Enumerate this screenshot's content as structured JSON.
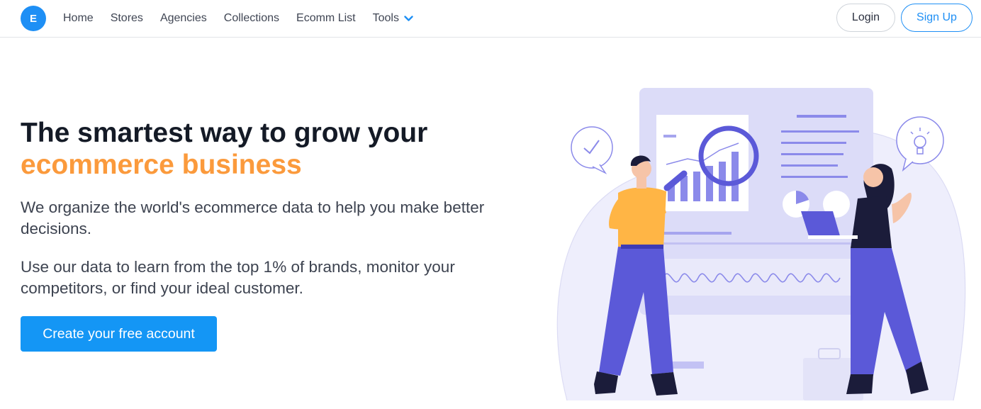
{
  "brand": {
    "logo_letter": "E"
  },
  "nav": {
    "links": [
      "Home",
      "Stores",
      "Agencies",
      "Collections",
      "Ecomm List"
    ],
    "tools_label": "Tools",
    "login_label": "Login",
    "signup_label": "Sign Up"
  },
  "hero": {
    "headline_part1": "The smartest way to grow your",
    "headline_highlight": "ecommerce business",
    "paragraph1": "We organize the world's ecommerce data to help you make better decisions.",
    "paragraph2": "Use our data to learn from the top 1% of brands, monitor your competitors, or find your ideal customer.",
    "cta_label": "Create your free account"
  },
  "colors": {
    "accent_blue": "#1496f5",
    "highlight_orange": "#fb9a3c",
    "illustration_purple": "#5b59d8"
  },
  "icons": [
    "chevron-down-icon",
    "checkmark-speech-bubble-icon",
    "lightbulb-speech-bubble-icon",
    "magnifying-glass-icon"
  ]
}
